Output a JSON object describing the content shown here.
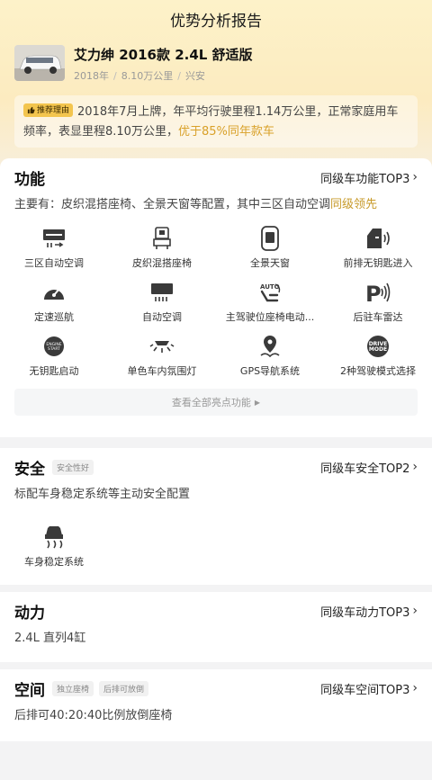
{
  "header": {
    "title": "优势分析报告"
  },
  "car": {
    "name": "艾力绅 2016款 2.4L 舒适版",
    "year": "2018年",
    "mileage": "8.10万公里",
    "city": "兴安"
  },
  "reason": {
    "tag": "推荐理由",
    "text": "2018年7月上牌，年平均行驶里程1.14万公里，正常家庭用车频率，表显里程8.10万公里，",
    "highlight": "优于85%同年款车"
  },
  "function_section": {
    "title": "功能",
    "top_link": "同级车功能TOP3",
    "desc": "主要有：皮织混搭座椅、全景天窗等配置，其中三区自动空调",
    "desc_highlight": "同级领先",
    "features": [
      {
        "label": "三区自动空调",
        "icon": "ac-icon"
      },
      {
        "label": "皮织混搭座椅",
        "icon": "seat-icon"
      },
      {
        "label": "全景天窗",
        "icon": "sunroof-icon"
      },
      {
        "label": "前排无钥匙进入",
        "icon": "keyless-entry-icon"
      },
      {
        "label": "定速巡航",
        "icon": "cruise-icon"
      },
      {
        "label": "自动空调",
        "icon": "auto-ac-icon"
      },
      {
        "label": "主驾驶位座椅电动...",
        "icon": "power-seat-icon"
      },
      {
        "label": "后驻车雷达",
        "icon": "parking-radar-icon"
      },
      {
        "label": "无钥匙启动",
        "icon": "start-button-icon"
      },
      {
        "label": "单色车内氛围灯",
        "icon": "ambient-light-icon"
      },
      {
        "label": "GPS导航系统",
        "icon": "gps-icon"
      },
      {
        "label": "2种驾驶模式选择",
        "icon": "drive-mode-icon"
      }
    ],
    "view_all": "查看全部亮点功能"
  },
  "safety_section": {
    "title": "安全",
    "tag": "安全性好",
    "top_link": "同级车安全TOP2",
    "desc": "标配车身稳定系统等主动安全配置",
    "features": [
      {
        "label": "车身稳定系统",
        "icon": "stability-icon"
      }
    ]
  },
  "power_section": {
    "title": "动力",
    "top_link": "同级车动力TOP3",
    "desc": "2.4L 直列4缸"
  },
  "space_section": {
    "title": "空间",
    "tags": [
      "独立座椅",
      "后排可放倒"
    ],
    "top_link": "同级车空间TOP3",
    "desc": "后排可40:20:40比例放倒座椅"
  }
}
